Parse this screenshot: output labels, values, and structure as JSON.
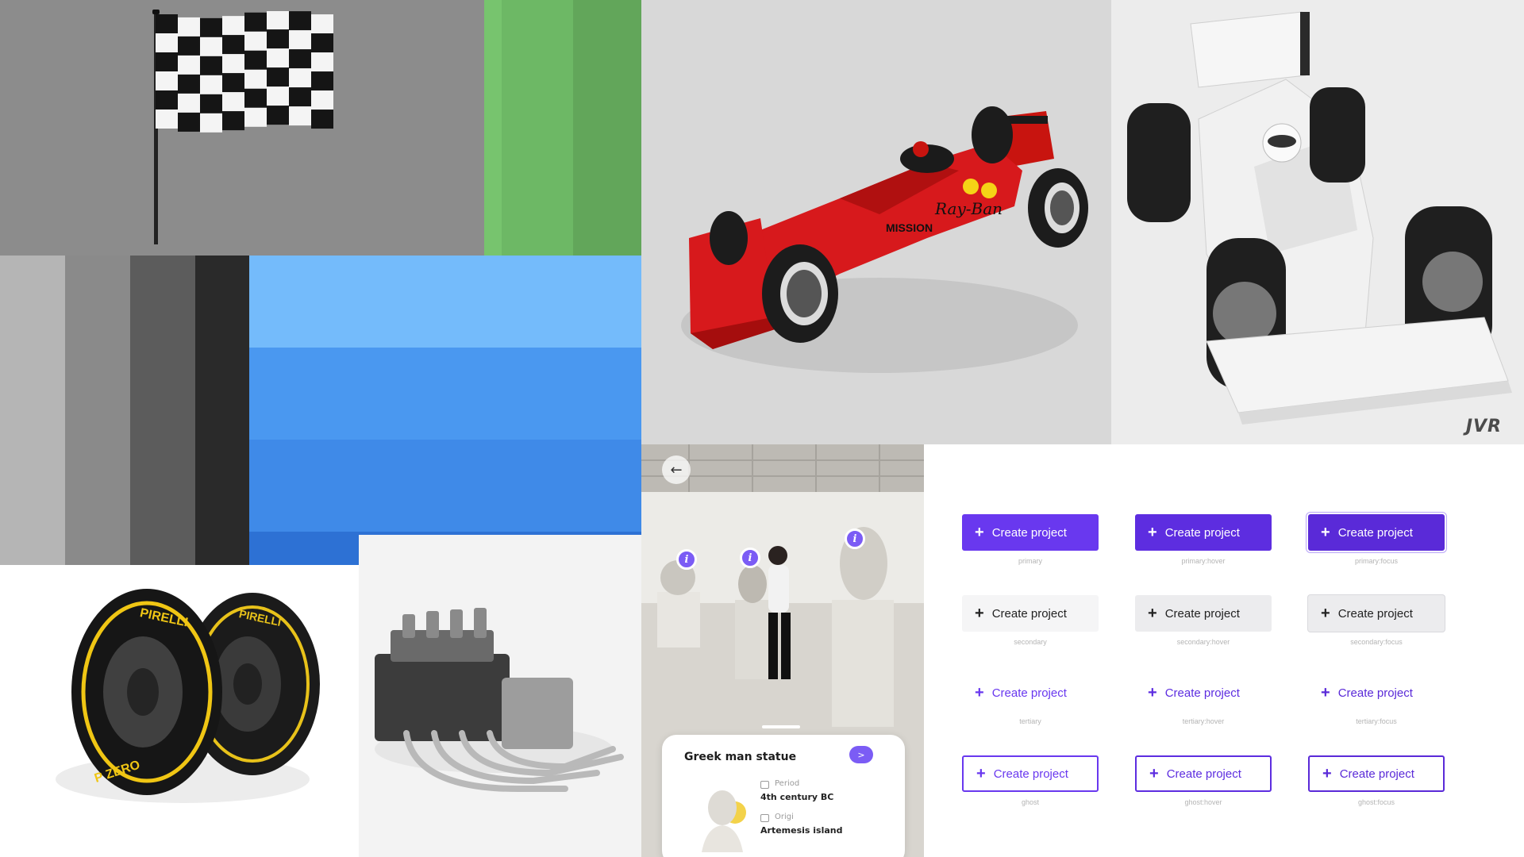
{
  "palette": {
    "greens": [
      "#77c46e",
      "#6db865",
      "#62a65a"
    ],
    "grays": [
      "#b5b5b5",
      "#8a8a8a",
      "#5c5c5c",
      "#2a2a2a"
    ],
    "blues": [
      "#74bbfb",
      "#4a98f0",
      "#3f8ae8",
      "#2d71d4"
    ]
  },
  "white_car": {
    "watermark": "JVR"
  },
  "museum_app": {
    "back_icon": "arrow-left-icon",
    "hotspot_glyph": "i",
    "card": {
      "title": "Greek man statue",
      "next_glyph": ">",
      "period_label": "Period",
      "period_value": "4th century BC",
      "origin_label": "Origi",
      "origin_value": "Artemesis island"
    }
  },
  "buttons": {
    "label": "Create project",
    "icon": "plus-icon",
    "accent": "#6938ef",
    "variants": [
      "primary",
      "primary:hover",
      "primary:focus",
      "secondary",
      "secondary:hover",
      "secondary:focus",
      "tertiary",
      "tertiary:hover",
      "tertiary:focus",
      "ghost",
      "ghost:hover",
      "ghost:focus"
    ]
  },
  "tyres": {
    "brand": "PIRELLI",
    "compound": "P ZERO"
  }
}
